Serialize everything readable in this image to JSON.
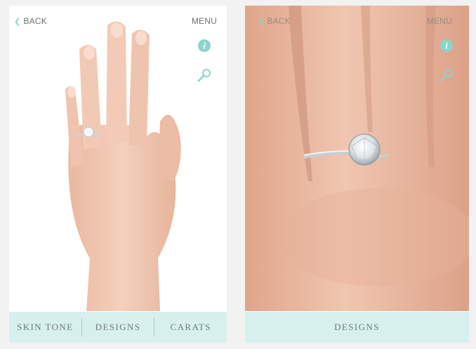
{
  "left": {
    "back_label": "BACK",
    "menu_label": "MENU",
    "info_icon": "info-icon",
    "zoom_icon": "magnifier-icon",
    "tabs": [
      "SKIN TONE",
      "DESIGNS",
      "CARATS"
    ]
  },
  "right": {
    "back_label": "BACK",
    "menu_label": "MENU",
    "info_icon": "info-icon",
    "zoom_icon": "magnifier-icon",
    "tabs": [
      "DESIGNS"
    ]
  },
  "colors": {
    "accent": "#8fd3cc",
    "bottom_bar": "#d8f0ed",
    "skin": "#f1c9b3"
  }
}
